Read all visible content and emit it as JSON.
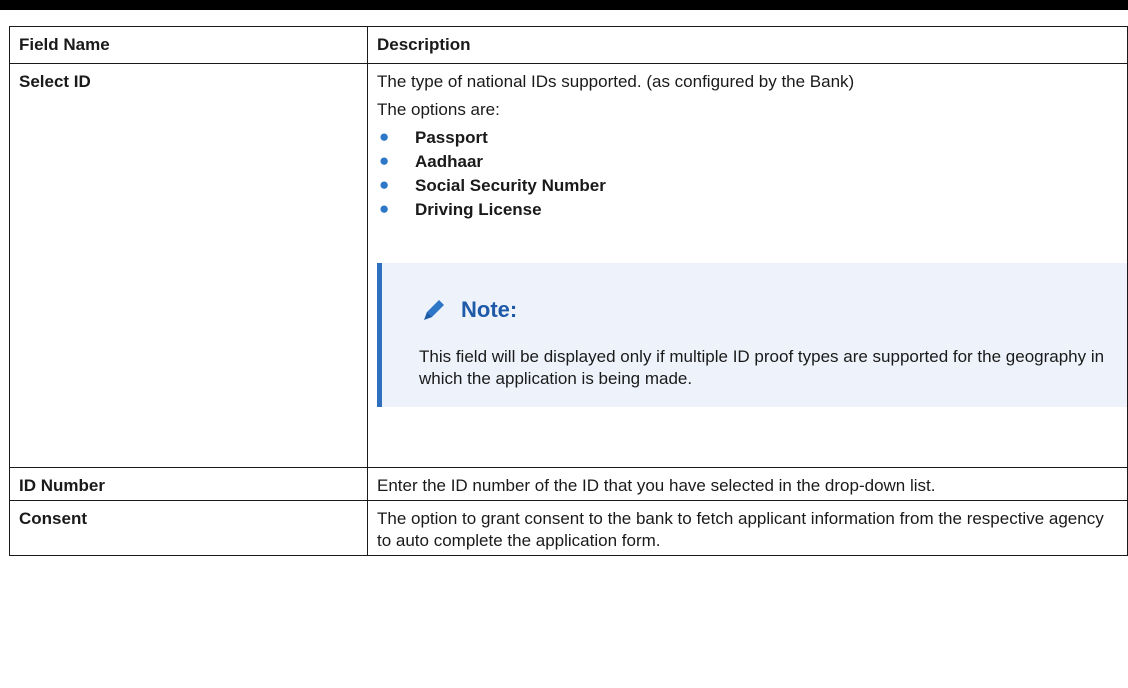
{
  "table": {
    "headers": [
      "Field Name",
      "Description"
    ],
    "rows": [
      {
        "field": "Select ID",
        "description": "The type of national IDs supported. (as configured by the Bank)",
        "options_intro": "The options are:",
        "options": [
          "Passport",
          "Aadhaar",
          "Social Security Number",
          "Driving License"
        ],
        "note": {
          "title": "Note:",
          "icon": "pencil-icon",
          "text": "This field will be displayed only if multiple ID proof types are supported for the geography in which the application is being made."
        }
      },
      {
        "field": "ID Number",
        "description": "Enter the ID number of the ID that you have selected in the drop-down list."
      },
      {
        "field": "Consent",
        "description": "The option to grant consent to the bank to fetch applicant information from the respective agency to auto complete the application form."
      }
    ]
  },
  "colors": {
    "bullet": "#2d77c6",
    "note_border": "#2f6fbf",
    "note_bg": "#eef3fb",
    "note_title": "#1e5aa8"
  }
}
